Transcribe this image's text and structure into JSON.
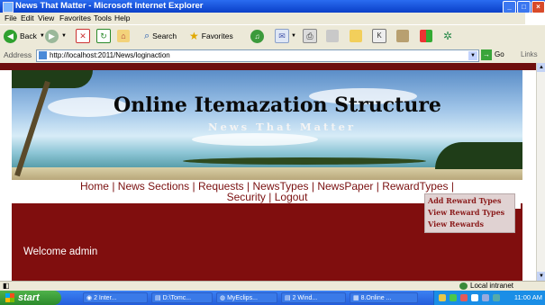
{
  "window": {
    "title": "News That Matter - Microsoft Internet Explorer"
  },
  "menu": [
    "File",
    "Edit",
    "View",
    "Favorites",
    "Tools",
    "Help"
  ],
  "toolbar": {
    "back_label": "Back",
    "search_label": "Search",
    "favorites_label": "Favorites"
  },
  "address": {
    "label": "Address",
    "url": "http://localhost:2011/News/loginaction",
    "go_label": "Go",
    "links_label": "Links"
  },
  "banner": {
    "title": "Online Itemazation Structure",
    "subtitle": "News That Matter"
  },
  "nav": {
    "items": [
      "Home",
      "News Sections",
      "Requests",
      "NewsTypes",
      "NewsPaper",
      "RewardTypes",
      "Security",
      "Logout"
    ],
    "separator": "|"
  },
  "dropdown": [
    "Add Reward Types",
    "View Reward Types",
    "View Rewards"
  ],
  "welcome": "Welcome admin",
  "status": {
    "zone": "Local intranet"
  },
  "taskbar": {
    "start_label": "start",
    "items": [
      "2 Inter...",
      "D:\\Tomc...",
      "MyEclips...",
      "2 Wind...",
      "8.Online ..."
    ],
    "clock": "11:00 AM"
  }
}
